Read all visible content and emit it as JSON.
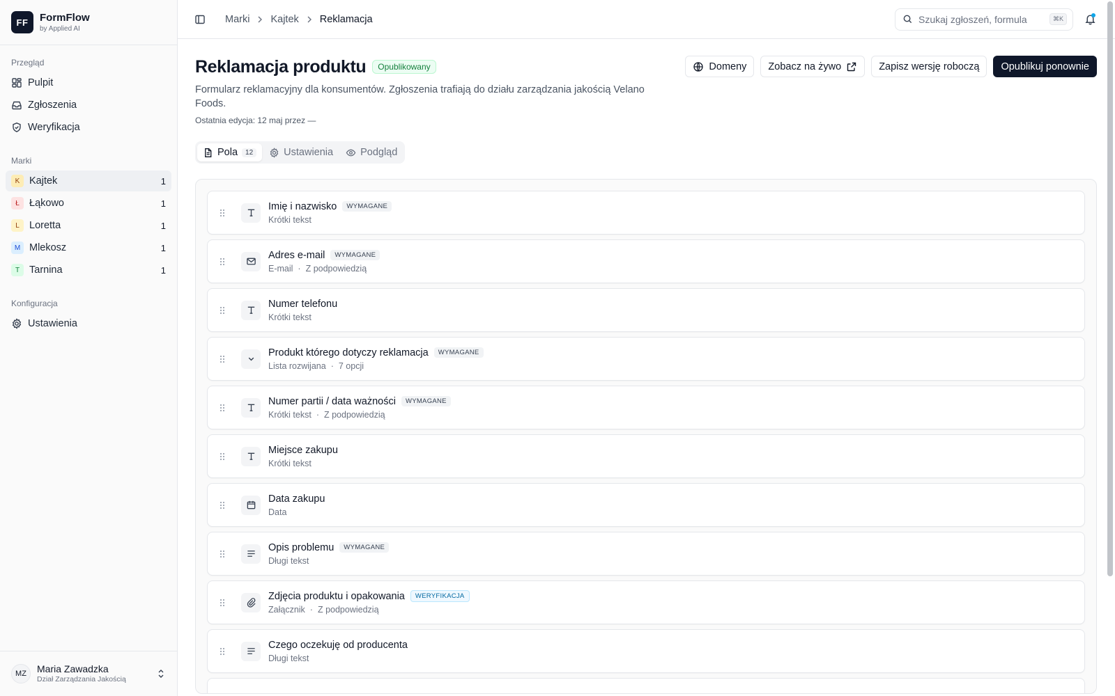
{
  "brand": {
    "logo": "FF",
    "name": "FormFlow",
    "sub": "by Applied AI"
  },
  "sidebar": {
    "overview_title": "Przegląd",
    "overview_items": [
      {
        "label": "Pulpit",
        "icon": "dashboard-icon"
      },
      {
        "label": "Zgłoszenia",
        "icon": "inbox-icon"
      },
      {
        "label": "Weryfikacja",
        "icon": "shield-icon"
      }
    ],
    "brands_title": "Marki",
    "brands": [
      {
        "letter": "K",
        "label": "Kajtek",
        "count": "1",
        "bg": "#fdecb5",
        "fg": "#92400e"
      },
      {
        "letter": "Ł",
        "label": "Łąkowo",
        "count": "1",
        "bg": "#fde2e2",
        "fg": "#b91c1c"
      },
      {
        "letter": "L",
        "label": "Loretta",
        "count": "1",
        "bg": "#fef3c7",
        "fg": "#92400e"
      },
      {
        "letter": "M",
        "label": "Mlekosz",
        "count": "1",
        "bg": "#dbeefe",
        "fg": "#1d4ed8"
      },
      {
        "letter": "T",
        "label": "Tarnina",
        "count": "1",
        "bg": "#dcfce7",
        "fg": "#15803d"
      }
    ],
    "config_title": "Konfiguracja",
    "config_items": [
      {
        "label": "Ustawienia",
        "icon": "gear-icon"
      }
    ]
  },
  "user": {
    "initials": "MZ",
    "name": "Maria Zawadzka",
    "role": "Dział Zarządzania Jakością"
  },
  "topbar": {
    "breadcrumb": [
      "Marki",
      "Kajtek",
      "Reklamacja"
    ],
    "search_placeholder": "Szukaj zgłoszeń, formula",
    "search_kbd": "⌘K"
  },
  "page": {
    "title": "Reklamacja produktu",
    "status": "Opublikowany",
    "description": "Formularz reklamacyjny dla konsumentów. Zgłoszenia trafiają do działu zarządzania jakością Velano Foods.",
    "last_edit": "Ostatnia edycja: 12 maj przez —",
    "actions": {
      "domains": "Domeny",
      "view_live": "Zobacz na żywo",
      "save_draft": "Zapisz wersję roboczą",
      "republish": "Opublikuj ponownie"
    }
  },
  "tabs": {
    "fields": "Pola",
    "fields_count": "12",
    "settings": "Ustawienia",
    "preview": "Podgląd"
  },
  "fields": [
    {
      "name": "Imię i nazwisko",
      "tag": "WYMAGANE",
      "tag_type": "required",
      "type": "Krótki tekst",
      "hint": "",
      "icon": "text-icon"
    },
    {
      "name": "Adres e-mail",
      "tag": "WYMAGANE",
      "tag_type": "required",
      "type": "E-mail",
      "hint": "Z podpowiedzią",
      "icon": "mail-icon"
    },
    {
      "name": "Numer telefonu",
      "tag": "",
      "tag_type": "",
      "type": "Krótki tekst",
      "hint": "",
      "icon": "text-icon"
    },
    {
      "name": "Produkt którego dotyczy reklamacja",
      "tag": "WYMAGANE",
      "tag_type": "required",
      "type": "Lista rozwijana",
      "hint": "7 opcji",
      "icon": "chevron-down-icon"
    },
    {
      "name": "Numer partii / data ważności",
      "tag": "WYMAGANE",
      "tag_type": "required",
      "type": "Krótki tekst",
      "hint": "Z podpowiedzią",
      "icon": "text-icon"
    },
    {
      "name": "Miejsce zakupu",
      "tag": "",
      "tag_type": "",
      "type": "Krótki tekst",
      "hint": "",
      "icon": "text-icon"
    },
    {
      "name": "Data zakupu",
      "tag": "",
      "tag_type": "",
      "type": "Data",
      "hint": "",
      "icon": "calendar-icon"
    },
    {
      "name": "Opis problemu",
      "tag": "WYMAGANE",
      "tag_type": "required",
      "type": "Długi tekst",
      "hint": "",
      "icon": "paragraph-icon"
    },
    {
      "name": "Zdjęcia produktu i opakowania",
      "tag": "WERYFIKACJA",
      "tag_type": "verify",
      "type": "Załącznik",
      "hint": "Z podpowiedzią",
      "icon": "paperclip-icon"
    },
    {
      "name": "Czego oczekuję od producenta",
      "tag": "",
      "tag_type": "",
      "type": "Długi tekst",
      "hint": "",
      "icon": "paragraph-icon"
    }
  ],
  "meta_separator": "·"
}
